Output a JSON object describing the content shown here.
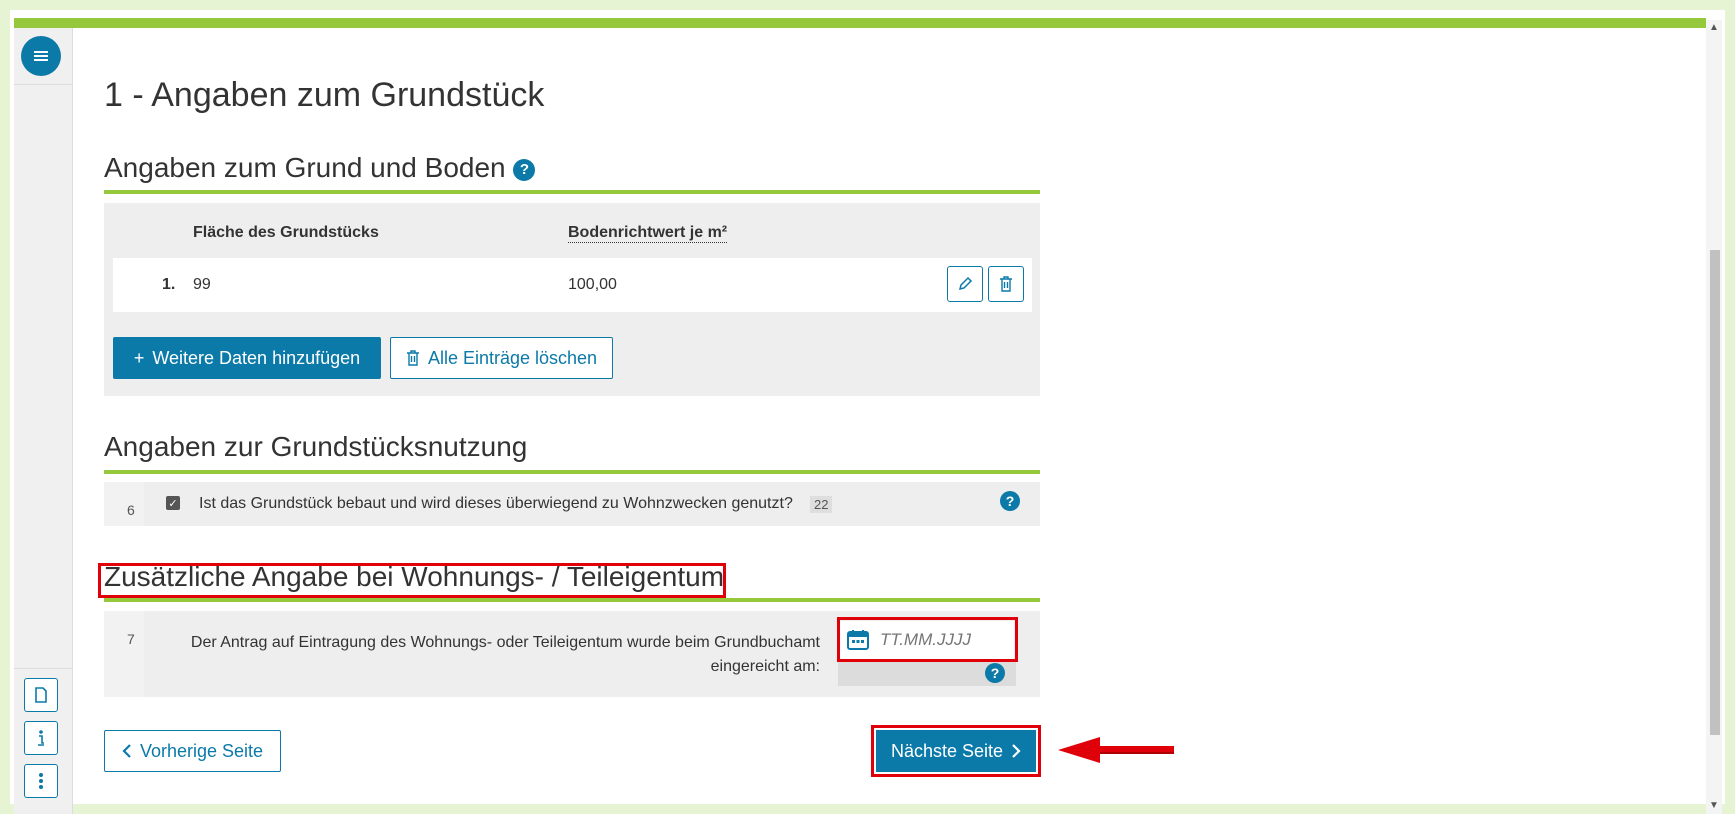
{
  "page_title": "1 - Angaben zum Grundstück",
  "sections": {
    "grund_boden": {
      "title": "Angaben zum Grund und Boden",
      "columns": [
        "Fläche des Grundstücks",
        "Bodenrichtwert je m²"
      ],
      "rows": [
        {
          "index": "1.",
          "flaeche": "99",
          "bodenrichtwert": "100,00"
        }
      ],
      "add_button": "Weitere Daten hinzufügen",
      "delete_all_button": "Alle Einträge löschen"
    },
    "nutzung": {
      "title": "Angaben zur Grundstücksnutzung",
      "field_number": "6",
      "checkbox_label": "Ist das Grundstück bebaut und wird dieses überwiegend zu Wohnzwecken genutzt?",
      "badge": "22",
      "checked": true
    },
    "wohnungseigentum": {
      "title": "Zusätzliche Angabe bei Wohnungs- / Teileigentum",
      "field_number": "7",
      "label_line1": "Der Antrag auf Eintragung des Wohnungs- oder Teileigentum wurde beim Grundbuchamt",
      "label_line2": "eingereicht am:",
      "date_placeholder": "TT.MM.JJJJ",
      "date_value": ""
    }
  },
  "navigation": {
    "prev_label": "Vorherige Seite",
    "next_label": "Nächste Seite"
  },
  "icons": {
    "menu": "hamburger-menu-icon",
    "document": "document-icon",
    "info": "info-icon",
    "more": "more-vertical-icon"
  },
  "colors": {
    "accent_green": "#95c83a",
    "primary_blue": "#0b7aa8",
    "highlight_red": "#e0000a"
  }
}
